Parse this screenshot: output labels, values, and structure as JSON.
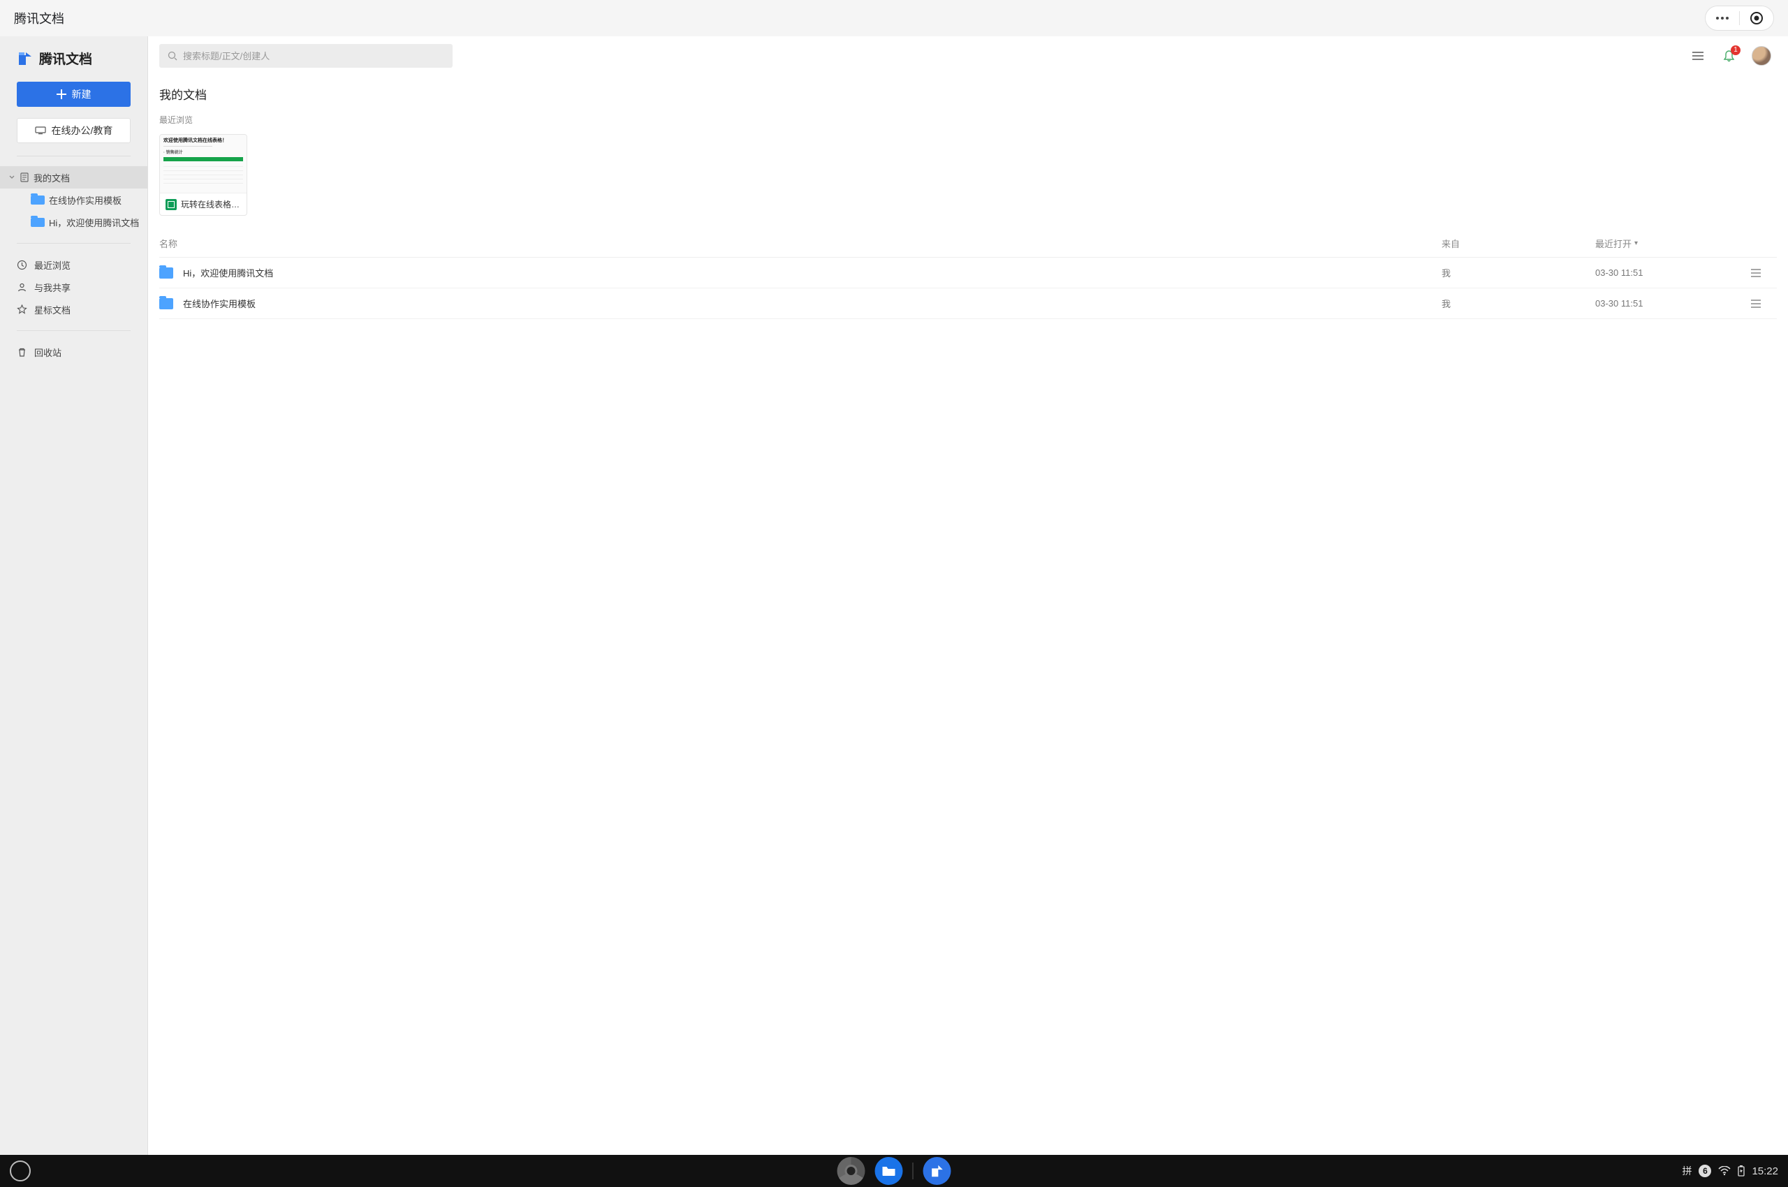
{
  "window": {
    "title": "腾讯文档"
  },
  "brand": {
    "name": "腾讯文档"
  },
  "sidebar": {
    "new_label": "新建",
    "online_label": "在线办公/教育",
    "tree": {
      "root": "我的文档",
      "children": [
        "在线协作实用模板",
        "Hi，欢迎使用腾讯文档"
      ]
    },
    "nav": {
      "recent": "最近浏览",
      "shared": "与我共享",
      "starred": "星标文档",
      "trash": "回收站"
    }
  },
  "search": {
    "placeholder": "搜索标题/正文/创建人"
  },
  "notifications": {
    "count": "1"
  },
  "main": {
    "page_title": "我的文档",
    "recent_label": "最近浏览",
    "recent_cards": [
      {
        "name": "玩转在线表格-场…",
        "thumb_title": "欢迎使用腾讯文档在线表格！"
      }
    ],
    "columns": {
      "name": "名称",
      "from": "来自",
      "time": "最近打开"
    },
    "rows": [
      {
        "name": "Hi，欢迎使用腾讯文档",
        "from": "我",
        "time": "03-30 11:51"
      },
      {
        "name": "在线协作实用模板",
        "from": "我",
        "time": "03-30 11:51"
      }
    ]
  },
  "taskbar": {
    "ime": "拼",
    "ime_badge": "6",
    "clock": "15:22"
  }
}
